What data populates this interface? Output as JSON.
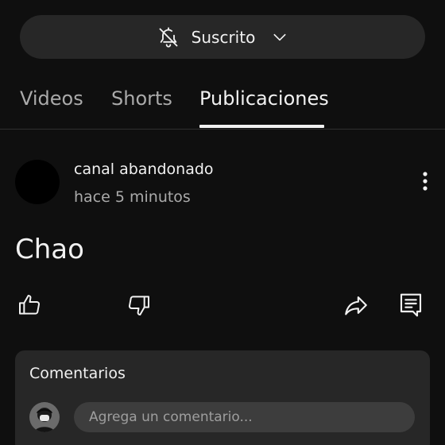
{
  "subscription": {
    "label": "Suscrito",
    "icon": "bell-off-icon",
    "dropdown_icon": "chevron-down-icon"
  },
  "tabs": [
    {
      "label": "Videos",
      "active": false
    },
    {
      "label": "Shorts",
      "active": false
    },
    {
      "label": "Publicaciones",
      "active": true
    }
  ],
  "post": {
    "channel_name": "canal abandonado",
    "time": "hace 5 minutos",
    "text": "Chao",
    "more_icon": "more-vertical-icon",
    "actions": {
      "like_icon": "thumbs-up-icon",
      "dislike_icon": "thumbs-down-icon",
      "share_icon": "share-icon",
      "comment_icon": "comment-icon"
    }
  },
  "comments": {
    "title": "Comentarios",
    "placeholder": "Agrega un comentario..."
  },
  "colors": {
    "background": "#0f0f0f",
    "surface": "#272727",
    "text_primary": "#f1f1f1",
    "text_secondary": "#aaaaaa"
  }
}
